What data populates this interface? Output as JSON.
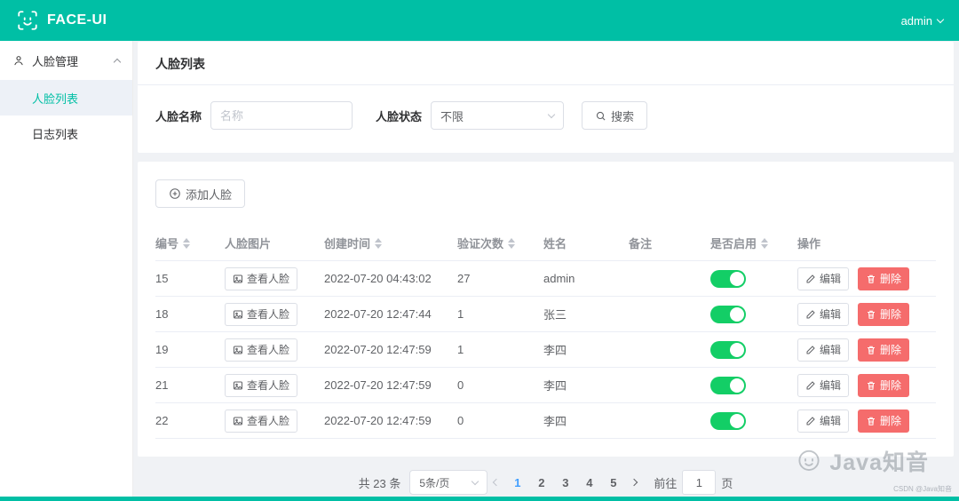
{
  "header": {
    "title": "FACE-UI",
    "user": "admin"
  },
  "sidebar": {
    "group_label": "人脸管理",
    "items": [
      {
        "label": "人脸列表",
        "active": true
      },
      {
        "label": "日志列表",
        "active": false
      }
    ]
  },
  "page": {
    "title": "人脸列表"
  },
  "filter": {
    "name_label": "人脸名称",
    "name_placeholder": "名称",
    "status_label": "人脸状态",
    "status_value": "不限",
    "search_label": "搜索"
  },
  "toolbar": {
    "add_label": "添加人脸"
  },
  "table": {
    "columns": [
      {
        "label": "编号",
        "sortable": true
      },
      {
        "label": "人脸图片",
        "sortable": false
      },
      {
        "label": "创建时间",
        "sortable": true
      },
      {
        "label": "验证次数",
        "sortable": true
      },
      {
        "label": "姓名",
        "sortable": false
      },
      {
        "label": "备注",
        "sortable": false
      },
      {
        "label": "是否启用",
        "sortable": true
      },
      {
        "label": "操作",
        "sortable": false
      }
    ],
    "view_face_label": "查看人脸",
    "edit_label": "编辑",
    "delete_label": "删除",
    "rows": [
      {
        "id": "15",
        "created": "2022-07-20 04:43:02",
        "count": "27",
        "name": "admin",
        "remark": "",
        "enabled": true
      },
      {
        "id": "18",
        "created": "2022-07-20 12:47:44",
        "count": "1",
        "name": "张三",
        "remark": "",
        "enabled": true
      },
      {
        "id": "19",
        "created": "2022-07-20 12:47:59",
        "count": "1",
        "name": "李四",
        "remark": "",
        "enabled": true
      },
      {
        "id": "21",
        "created": "2022-07-20 12:47:59",
        "count": "0",
        "name": "李四",
        "remark": "",
        "enabled": true
      },
      {
        "id": "22",
        "created": "2022-07-20 12:47:59",
        "count": "0",
        "name": "李四",
        "remark": "",
        "enabled": true
      }
    ]
  },
  "pagination": {
    "total": "共 23 条",
    "page_size": "5条/页",
    "pages": [
      "1",
      "2",
      "3",
      "4",
      "5"
    ],
    "active_page": "1",
    "goto_label": "前往",
    "goto_value": "1",
    "page_label": "页"
  },
  "watermark": {
    "text": "Java知音",
    "csdn": "CSDN @Java知音"
  },
  "colors": {
    "accent": "#00bfa5",
    "danger": "#f56c6c",
    "success": "#13ce66",
    "link": "#409eff"
  }
}
